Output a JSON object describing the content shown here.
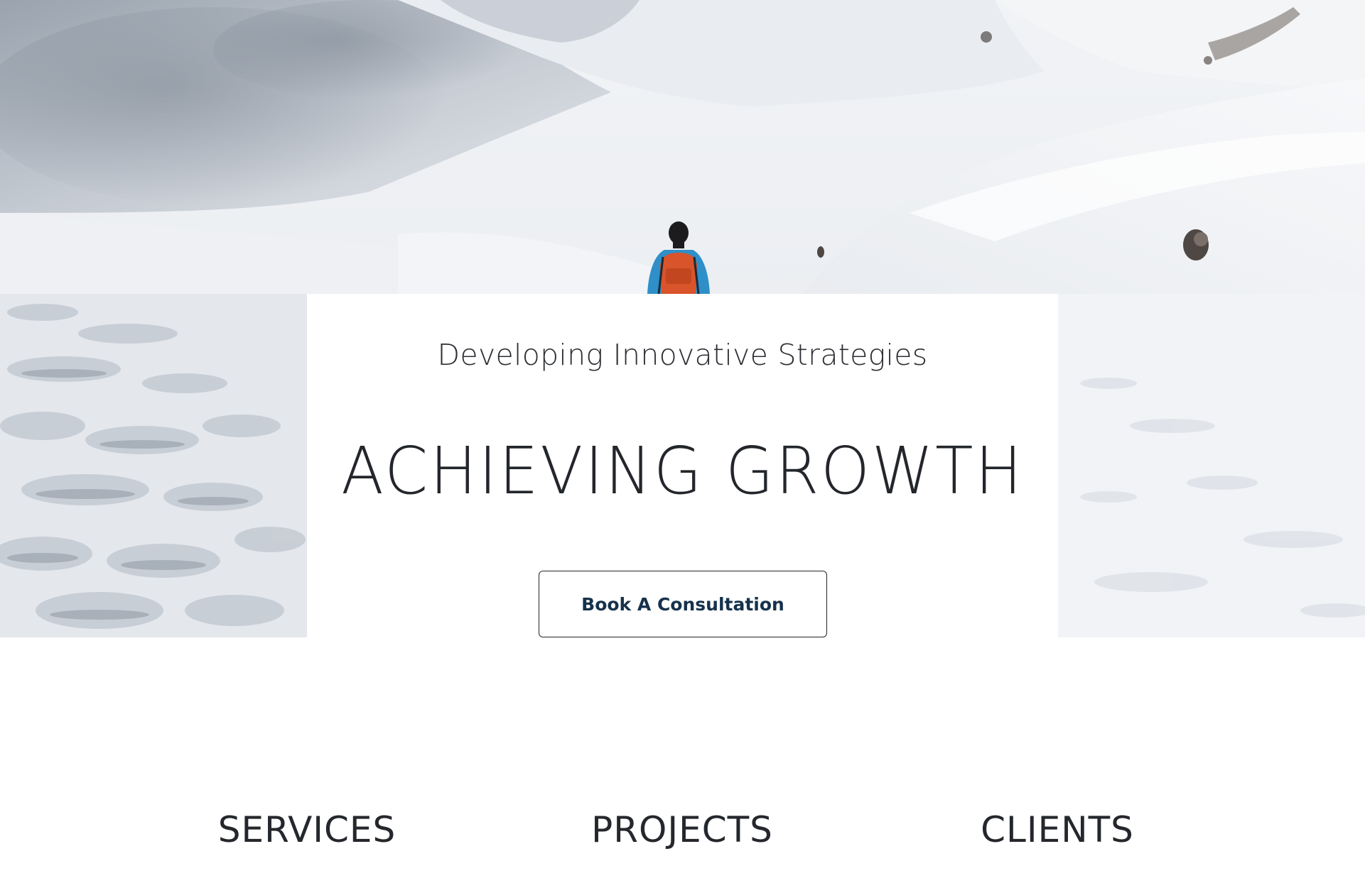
{
  "hero": {
    "image_description_icon": "snow-mountain-hiker-photo",
    "subtitle": "Developing Innovative Strategies",
    "title": "ACHIEVING GROWTH",
    "cta_label": "Book A Consultation"
  },
  "sections": {
    "items": [
      {
        "label": "SERVICES"
      },
      {
        "label": "PROJECTS"
      },
      {
        "label": "CLIENTS"
      }
    ]
  },
  "colors": {
    "text_dark": "#23262b",
    "button_text": "#16324c",
    "background": "#ffffff",
    "snow": "#eef1f5",
    "hiker_jacket": "#2f8fc8",
    "hiker_backpack": "#d9532b"
  }
}
